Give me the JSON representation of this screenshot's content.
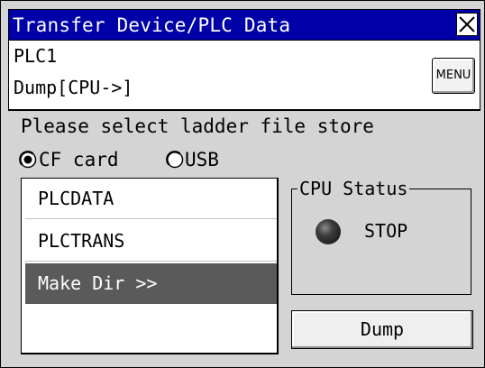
{
  "window": {
    "title": "Transfer Device/PLC Data",
    "close_icon": "close-x-icon"
  },
  "header": {
    "device": "PLC1",
    "mode": "Dump[CPU->]",
    "menu_label": "MENU"
  },
  "prompt": "Please select ladder file store",
  "storage": {
    "options": [
      {
        "label": "CF card",
        "selected": true
      },
      {
        "label": "USB",
        "selected": false
      }
    ]
  },
  "files": {
    "items": [
      {
        "label": "PLCDATA",
        "selected": false
      },
      {
        "label": "PLCTRANS",
        "selected": false
      },
      {
        "label": "Make Dir >>",
        "selected": true
      },
      {
        "label": "",
        "selected": false
      }
    ]
  },
  "cpu_status": {
    "legend": "CPU Status",
    "state": "STOP",
    "lamp_icon": "status-lamp-icon"
  },
  "actions": {
    "dump_label": "Dump"
  },
  "colors": {
    "title_bar": "#0000A8",
    "selected_row": "#5A5A5A",
    "panel": "#D4D4D4"
  }
}
